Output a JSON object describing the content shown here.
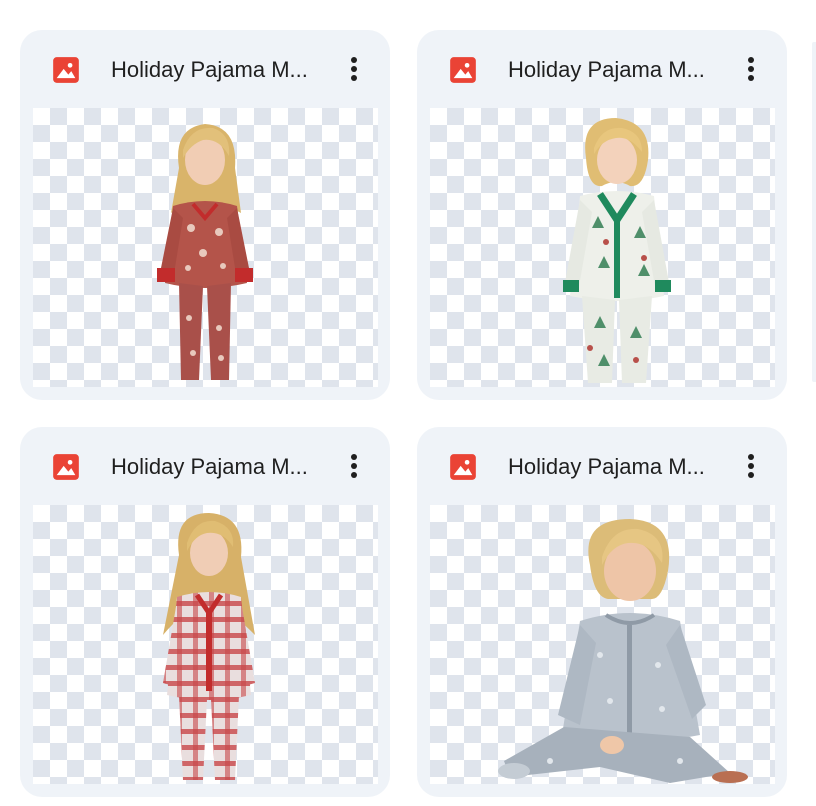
{
  "files": [
    {
      "name": "Holiday Pajama M...",
      "icon": "image-file-icon",
      "thumbnail": "child-red-snowflake-pajamas"
    },
    {
      "name": "Holiday Pajama M...",
      "icon": "image-file-icon",
      "thumbnail": "child-green-trim-christmas-tree-pajamas"
    },
    {
      "name": "Holiday Pajama M...",
      "icon": "image-file-icon",
      "thumbnail": "child-red-plaid-pajamas"
    },
    {
      "name": "Holiday Pajama M...",
      "icon": "image-file-icon",
      "thumbnail": "child-gray-sitting-pajamas"
    }
  ],
  "colors": {
    "card_background": "#eff3f8",
    "image_icon_red": "#ea4335",
    "text": "#1f1f1f",
    "checker": "#dfe4ec"
  }
}
